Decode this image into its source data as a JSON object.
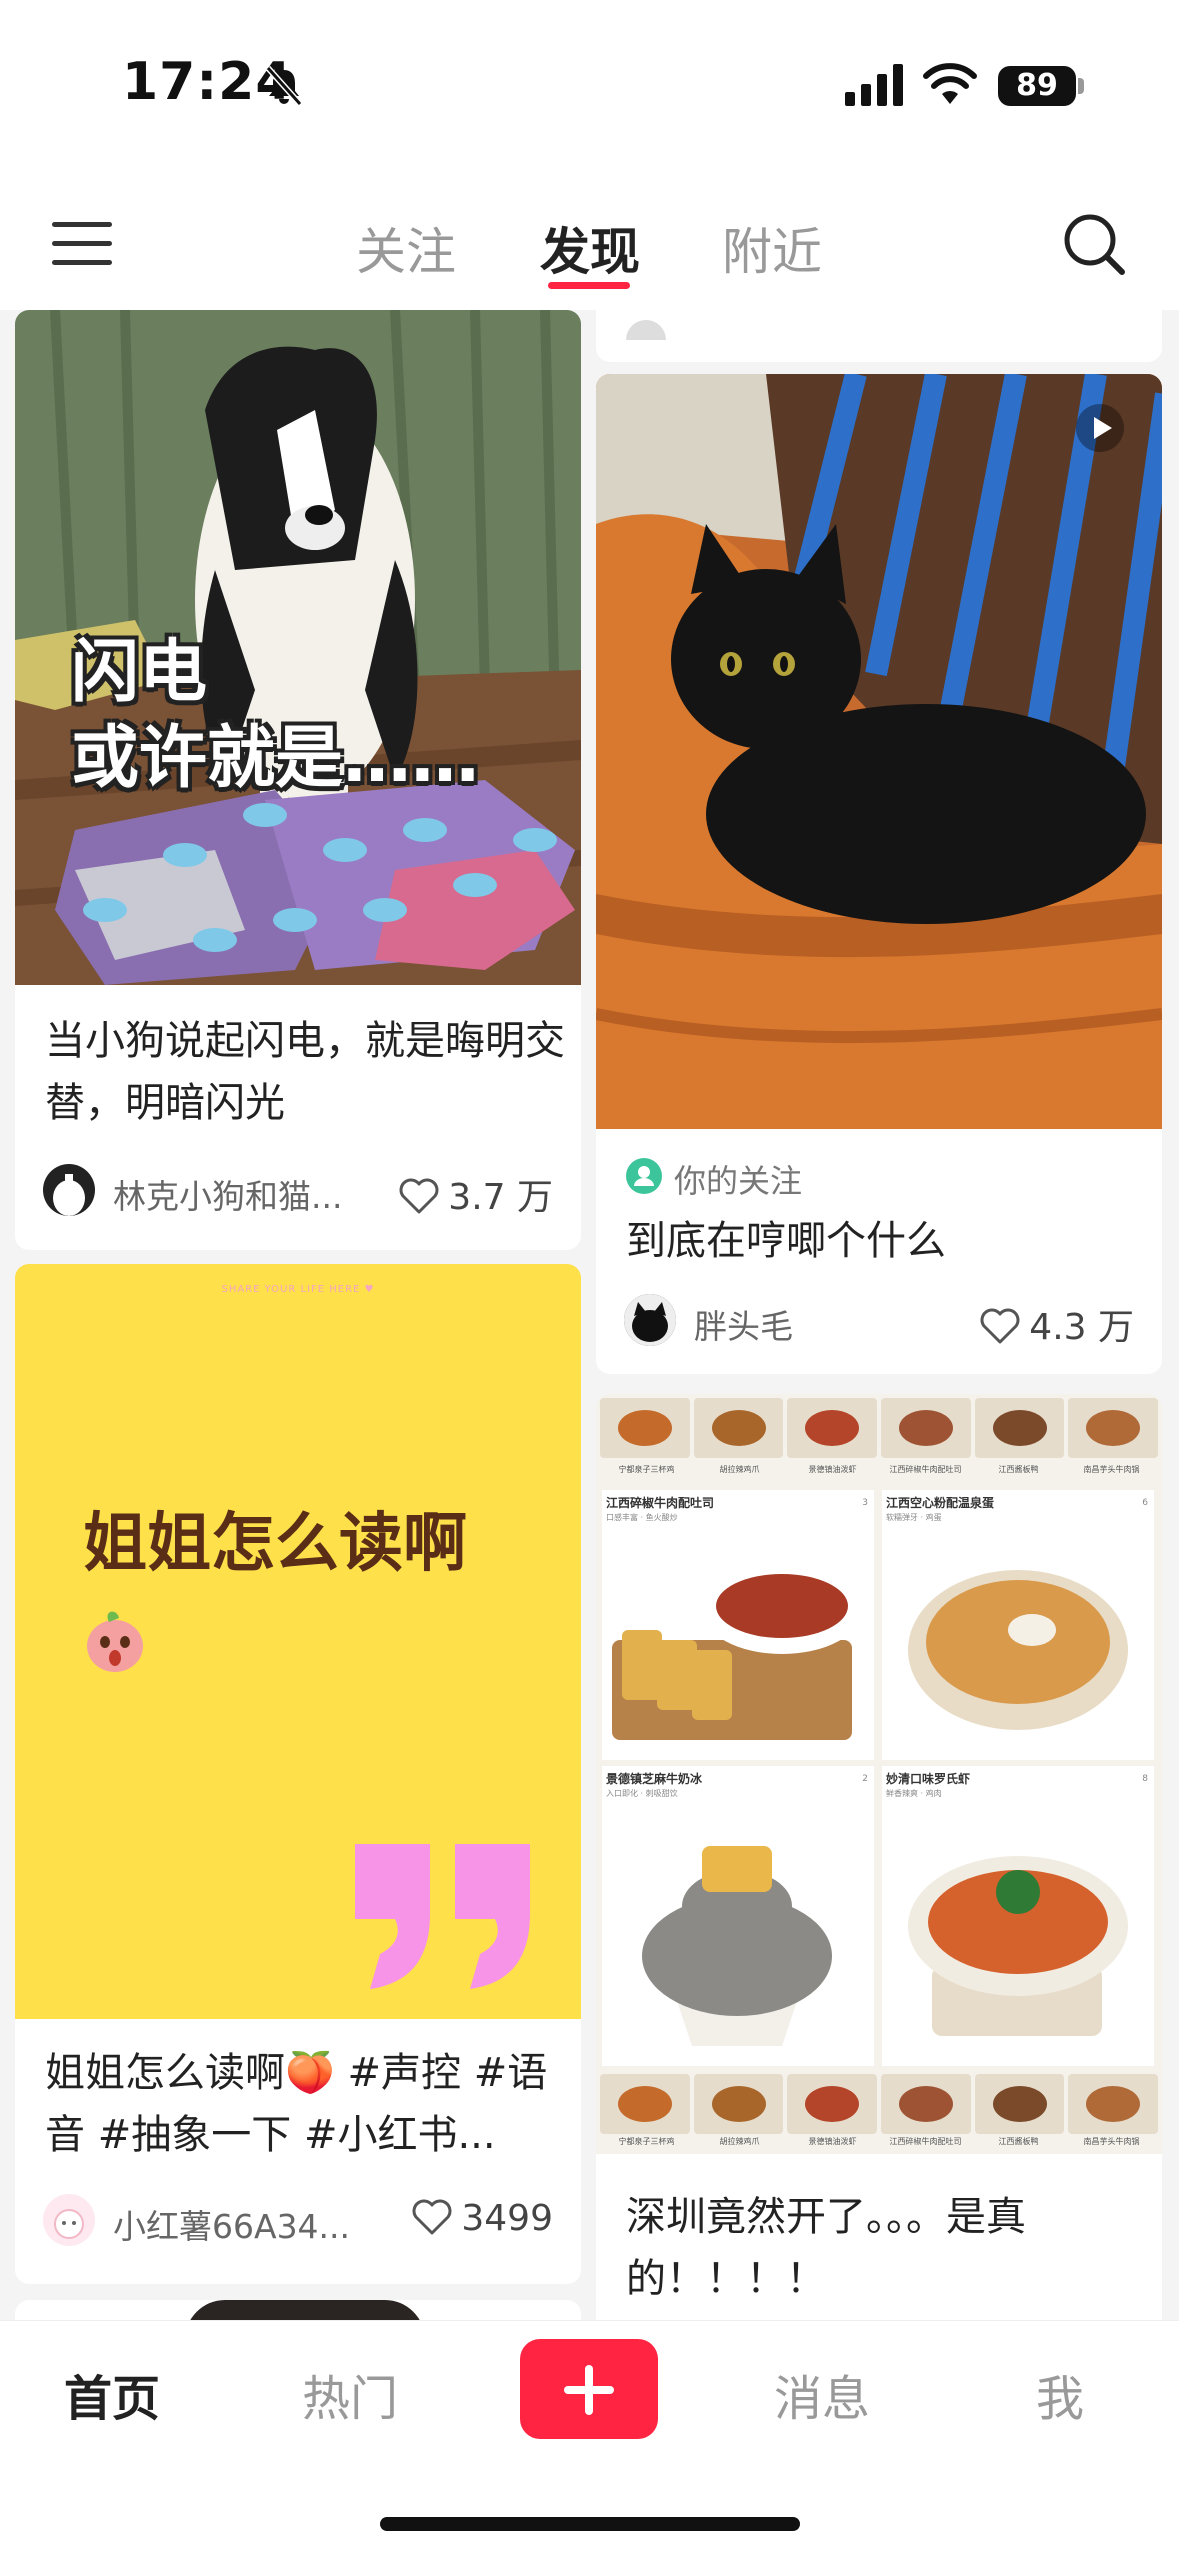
{
  "status_bar": {
    "time": "17:24",
    "battery": "89"
  },
  "header": {
    "tabs": [
      {
        "label": "关注"
      },
      {
        "label": "发现"
      },
      {
        "label": "附近"
      }
    ],
    "accent_color": "#ff2442"
  },
  "feed": {
    "cards": [
      {
        "image_overlay": "闪电\n或许就是……",
        "title": "当小狗说起闪电，就是晦明交替，明暗闪光",
        "author": "林克小狗和猫...",
        "likes": "3.7 万"
      },
      {
        "follow_tag": "你的关注",
        "title": "到底在哼唧个什么",
        "author": "胖头毛",
        "likes": "4.3 万",
        "is_video": true
      },
      {
        "image_small_text": "SHARE YOUR LIFE HERE ♥",
        "image_text": "姐姐怎么读啊",
        "title": "姐姐怎么读啊🍑 #声控 #语音 #抽象一下 #小红书...",
        "author": "小红薯66A34...",
        "likes": "3499"
      },
      {
        "food_labels": [
          "江西碎椒牛肉配吐司",
          "江西空心粉配温泉蛋",
          "景德镇芝麻牛奶冰",
          "妙清口味罗氏虾"
        ],
        "food_tags": [
          "口感丰富 · 鱼火酸炒",
          "软糯弹牙 · 鸡蛋",
          "入口即化 · 刺吸甜饮",
          "鲜香辣爽 · 鸡肉"
        ],
        "food_likes": [
          "3",
          "6",
          "2",
          "8"
        ],
        "thumb_captions": [
          "宁都泉子三杯鸡",
          "胡拉辣鸡爪",
          "景德镇油泼虾",
          "江西碎椒牛肉配吐司",
          "江西酱板鸭",
          "南昌芋头牛肉锅"
        ],
        "title": "深圳竟然开了。。。是真的！！！！"
      }
    ]
  },
  "bottom_nav": {
    "items": [
      {
        "label": "首页"
      },
      {
        "label": "热门"
      },
      {
        "label": "消息"
      },
      {
        "label": "我"
      }
    ]
  }
}
